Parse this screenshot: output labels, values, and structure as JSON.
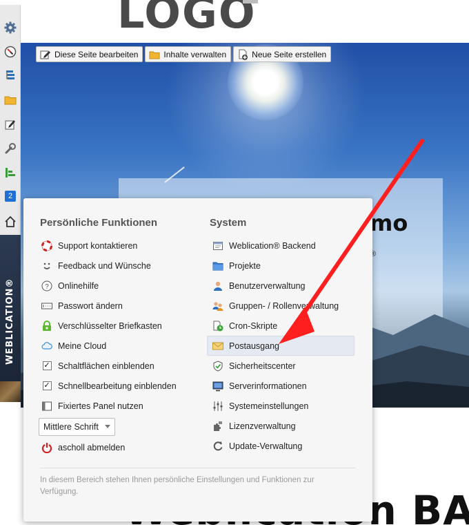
{
  "logo": {
    "text": "LOGO"
  },
  "edit_toolbar": [
    {
      "label": "Diese Seite bearbeiten",
      "icon": "pencil-icon"
    },
    {
      "label": "Inhalte verwalten",
      "icon": "folder-icon"
    },
    {
      "label": "Neue Seite erstellen",
      "icon": "new-page-icon"
    }
  ],
  "left_toolbar": {
    "icons": [
      "gear-icon",
      "compass-icon",
      "tree-icon",
      "folder-icon",
      "edit-icon",
      "wrench-icon",
      "chart-icon",
      "badge-icon",
      "home-icon"
    ],
    "badge_count": "2",
    "brand": "WEBLICATION®"
  },
  "hero": {
    "title_fragment": "mo",
    "reg_fragment": "®"
  },
  "bottom_heading": "Weblication BA",
  "menu": {
    "personal": {
      "heading": "Persönliche Funktionen",
      "items": [
        {
          "label": "Support kontaktieren",
          "icon": "lifebuoy-icon"
        },
        {
          "label": "Feedback und Wünsche",
          "icon": "feedback-icon"
        },
        {
          "label": "Onlinehilfe",
          "icon": "help-icon"
        },
        {
          "label": "Passwort ändern",
          "icon": "password-icon"
        },
        {
          "label": "Verschlüsselter Briefkasten",
          "icon": "lock-icon"
        },
        {
          "label": "Meine Cloud",
          "icon": "cloud-icon"
        },
        {
          "label": "Schaltflächen einblenden",
          "checked": true
        },
        {
          "label": "Schnellbearbeitung einblenden",
          "checked": true
        },
        {
          "label": "Fixiertes Panel nutzen",
          "icon": "panel-icon"
        }
      ],
      "font_select": "Mittlere Schrift",
      "logout": "ascholl abmelden"
    },
    "system": {
      "heading": "System",
      "items": [
        {
          "label": "Weblication® Backend",
          "icon": "backend-icon"
        },
        {
          "label": "Projekte",
          "icon": "projects-folder-icon"
        },
        {
          "label": "Benutzerverwaltung",
          "icon": "user-icon"
        },
        {
          "label": "Gruppen- / Rollenverwaltung",
          "icon": "group-icon"
        },
        {
          "label": "Cron-Skripte",
          "icon": "cron-icon"
        },
        {
          "label": "Postausgang",
          "icon": "mail-outbox-icon",
          "highlighted": true
        },
        {
          "label": "Sicherheitscenter",
          "icon": "shield-icon"
        },
        {
          "label": "Serverinformationen",
          "icon": "monitor-icon"
        },
        {
          "label": "Systemeinstellungen",
          "icon": "sliders-icon"
        },
        {
          "label": "Lizenzverwaltung",
          "icon": "puzzle-icon"
        },
        {
          "label": "Update-Verwaltung",
          "icon": "refresh-icon"
        }
      ]
    },
    "footer": "In diesem Bereich stehen Ihnen persönliche Einstellungen und Funktionen zur Verfügung."
  },
  "colors": {
    "annotation_arrow": "#ff1f1f",
    "brand_strip": "#26324a",
    "logout_icon": "#d32020"
  }
}
